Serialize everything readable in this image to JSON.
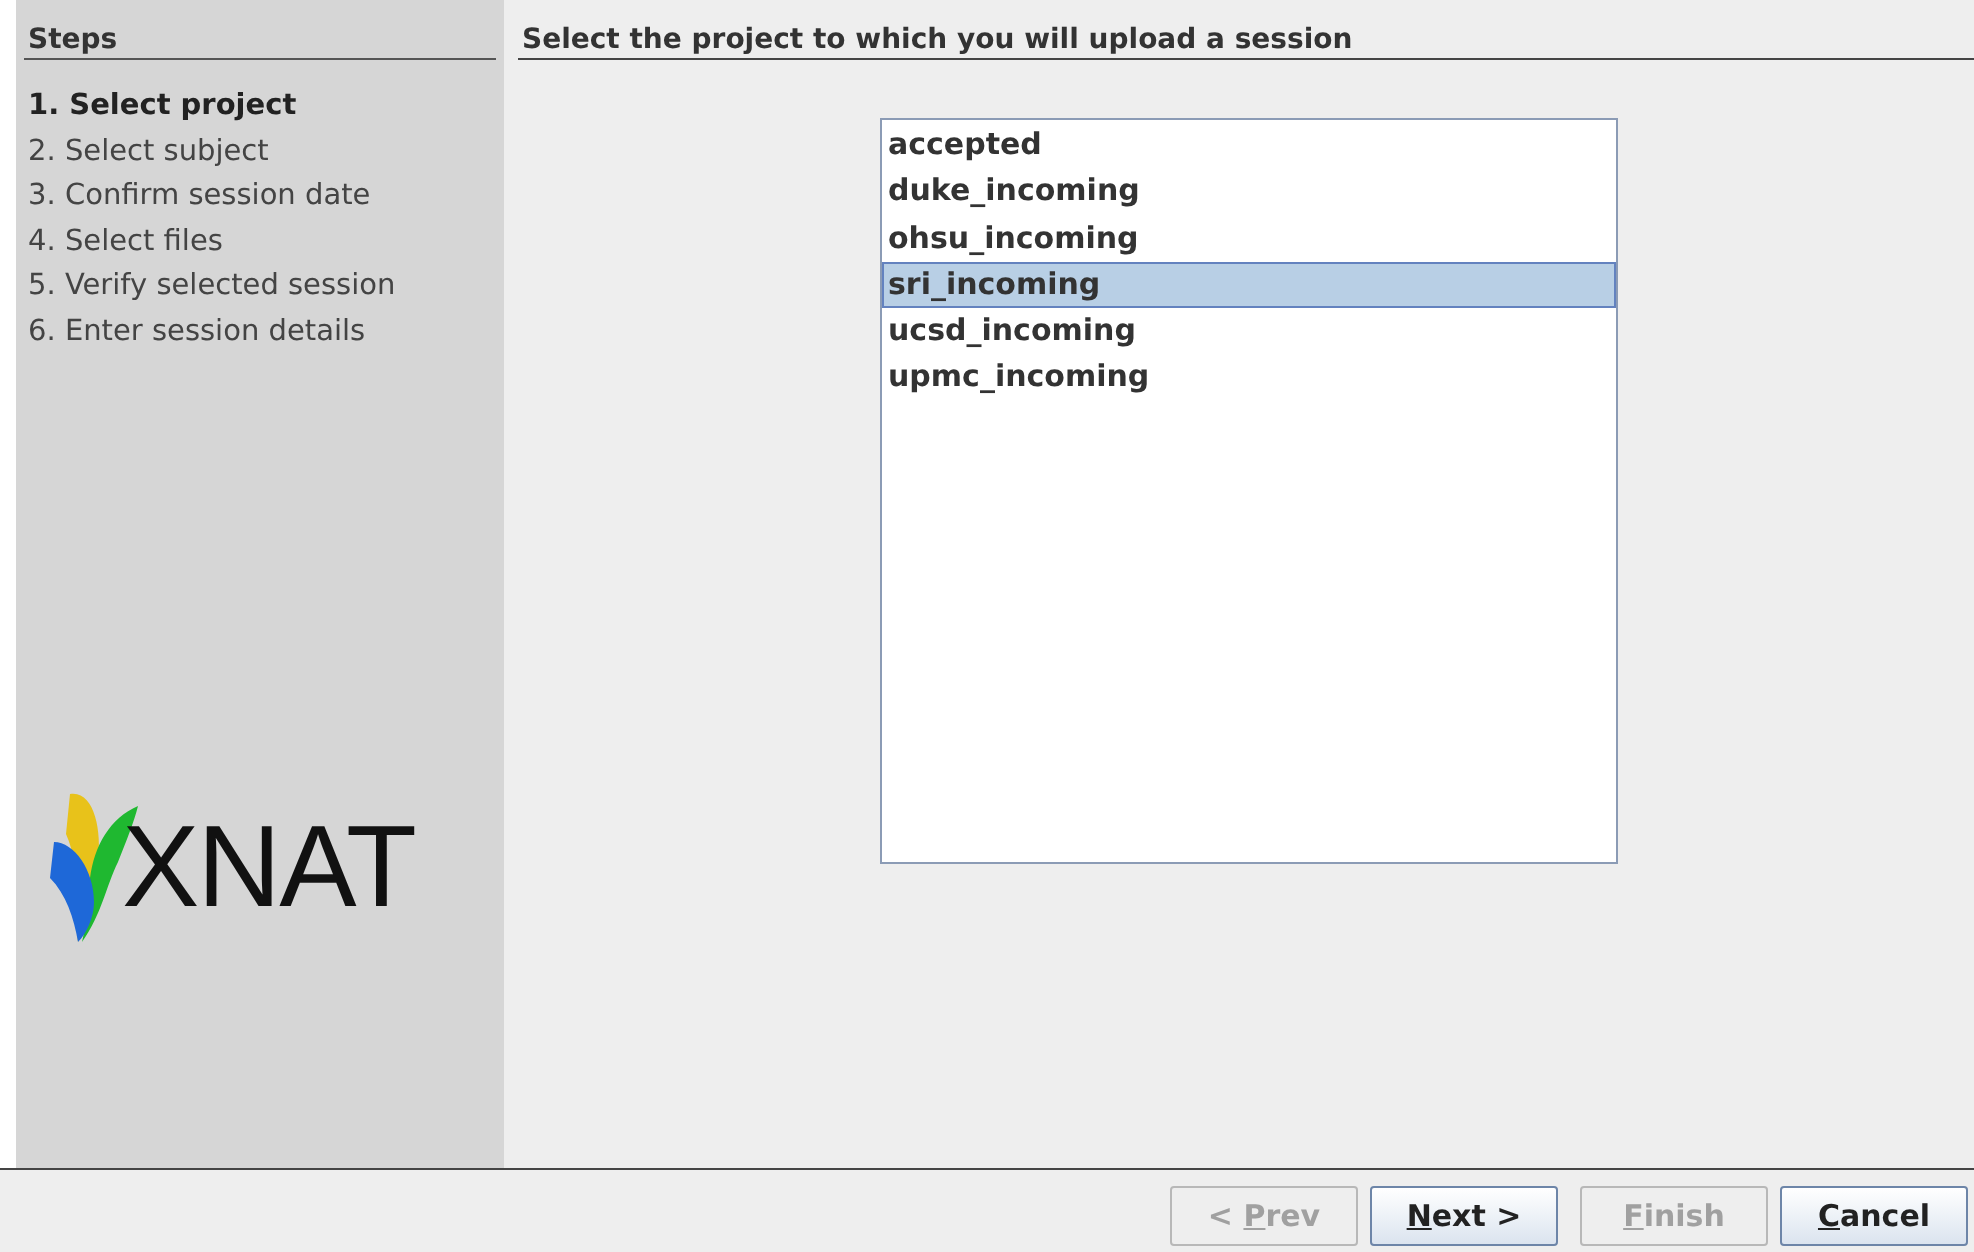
{
  "sidebar": {
    "title": "Steps",
    "steps": [
      {
        "label": "1. Select project",
        "selected": true
      },
      {
        "label": "2. Select subject",
        "selected": false
      },
      {
        "label": "3. Confirm session date",
        "selected": false
      },
      {
        "label": "4. Select files",
        "selected": false
      },
      {
        "label": "5. Verify selected session",
        "selected": false
      },
      {
        "label": "6. Enter session details",
        "selected": false
      }
    ],
    "logo": {
      "text": "XNAT"
    }
  },
  "main": {
    "title": "Select the project to which you will upload a session",
    "projects": [
      {
        "label": "accepted",
        "selected": false
      },
      {
        "label": "duke_incoming",
        "selected": false
      },
      {
        "label": "ohsu_incoming",
        "selected": false
      },
      {
        "label": "sri_incoming",
        "selected": true
      },
      {
        "label": "ucsd_incoming",
        "selected": false
      },
      {
        "label": "upmc_incoming",
        "selected": false
      }
    ]
  },
  "buttons": [
    {
      "label": "< Prev",
      "mnemonic_underlined": true,
      "disabled": true
    },
    {
      "label": "Next >",
      "mnemonic_underlined": true,
      "disabled": false
    },
    {
      "label": "Finish",
      "mnemonic_underlined": true,
      "disabled": true
    },
    {
      "label": "Cancel",
      "mnemonic_underlined": true,
      "disabled": false
    }
  ]
}
